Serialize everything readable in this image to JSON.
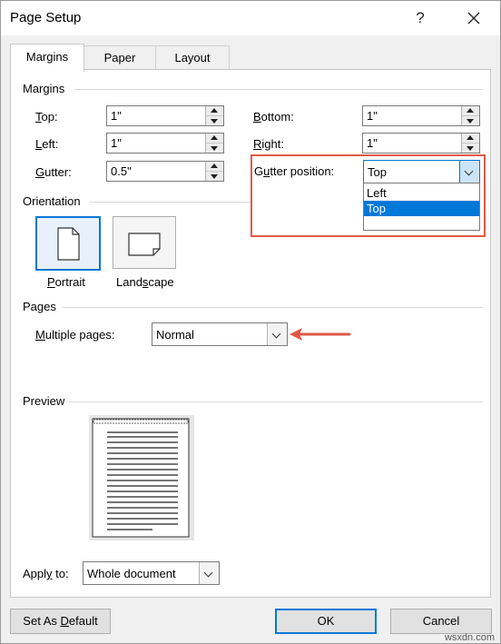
{
  "window": {
    "title": "Page Setup",
    "help_symbol": "?",
    "close_symbol": "✕"
  },
  "tabs": [
    {
      "label": "Margins",
      "active": true
    },
    {
      "label": "Paper",
      "active": false
    },
    {
      "label": "Layout",
      "active": false
    }
  ],
  "margins": {
    "group_label": "Margins",
    "top": {
      "label_ul": "T",
      "label_rest": "op:",
      "value": "1\""
    },
    "left": {
      "label_ul": "L",
      "label_rest": "eft:",
      "value": "1\""
    },
    "gutter": {
      "label_ul": "G",
      "label_rest": "utter:",
      "value": "0.5\""
    },
    "bottom": {
      "label_ul": "B",
      "label_rest": "ottom:",
      "value": "1\""
    },
    "right": {
      "label_ul": "R",
      "label_rest": "ight:",
      "value": "1\""
    },
    "gutter_position": {
      "label_ul": "u",
      "label_pre": "G",
      "label_rest": "tter position:",
      "value": "Top",
      "options": [
        "Left",
        "Top"
      ],
      "selected_option": "Top"
    }
  },
  "orientation": {
    "group_label": "Orientation",
    "portrait": {
      "label_ul": "P",
      "label_rest": "ortrait",
      "selected": true
    },
    "landscape": {
      "label_pre": "Land",
      "label_ul": "s",
      "label_rest": "cape",
      "selected": false
    }
  },
  "pages": {
    "group_label": "Pages",
    "multiple_pages": {
      "label_ul": "M",
      "label_rest": "ultiple pages:",
      "value": "Normal"
    }
  },
  "preview": {
    "group_label": "Preview"
  },
  "apply_to": {
    "label_pre": "Appl",
    "label_ul": "y",
    "label_rest": " to:",
    "value": "Whole document"
  },
  "buttons": {
    "set_default_pre": "Set As ",
    "set_default_ul": "D",
    "set_default_rest": "efault",
    "ok": "OK",
    "cancel": "Cancel"
  },
  "colors": {
    "accent": "#0078d7",
    "annotation_red": "#e05a48"
  },
  "watermark": "wsxdn.com"
}
